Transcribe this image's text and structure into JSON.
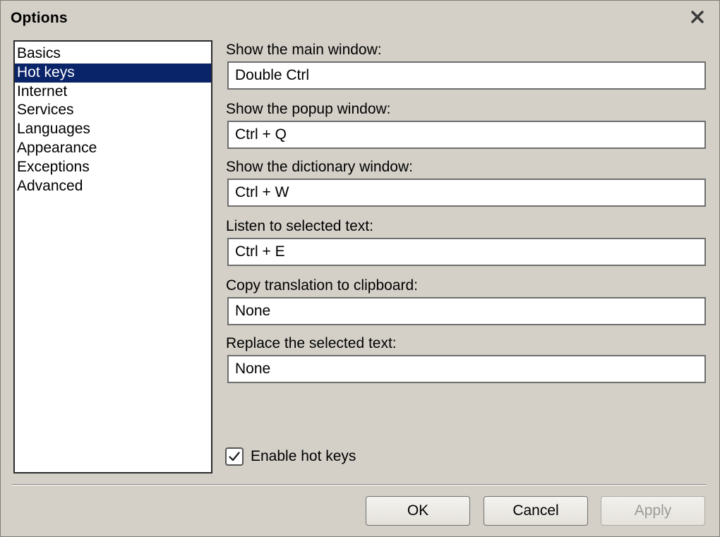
{
  "window": {
    "title": "Options",
    "close_icon": "close-icon"
  },
  "sidebar": {
    "selected_index": 1,
    "items": [
      {
        "label": "Basics"
      },
      {
        "label": "Hot keys"
      },
      {
        "label": "Internet"
      },
      {
        "label": "Services"
      },
      {
        "label": "Languages"
      },
      {
        "label": "Appearance"
      },
      {
        "label": "Exceptions"
      },
      {
        "label": "Advanced"
      }
    ]
  },
  "hotkeys": {
    "fields": [
      {
        "label": "Show the main window:",
        "value": "Double Ctrl"
      },
      {
        "label": "Show the popup window:",
        "value": "Ctrl + Q"
      },
      {
        "label": "Show the dictionary window:",
        "value": "Ctrl + W"
      },
      {
        "label": "Listen to selected text:",
        "value": "Ctrl + E"
      },
      {
        "label": "Copy translation to clipboard:",
        "value": "None"
      },
      {
        "label": "Replace the selected text:",
        "value": "None"
      }
    ],
    "enable": {
      "label": "Enable hot keys",
      "checked": true
    }
  },
  "buttons": {
    "ok": "OK",
    "cancel": "Cancel",
    "apply": "Apply",
    "apply_disabled": true
  },
  "colors": {
    "window_bg": "#d4d0c8",
    "selection_bg": "#0a246a",
    "selection_fg": "#ffffff"
  }
}
